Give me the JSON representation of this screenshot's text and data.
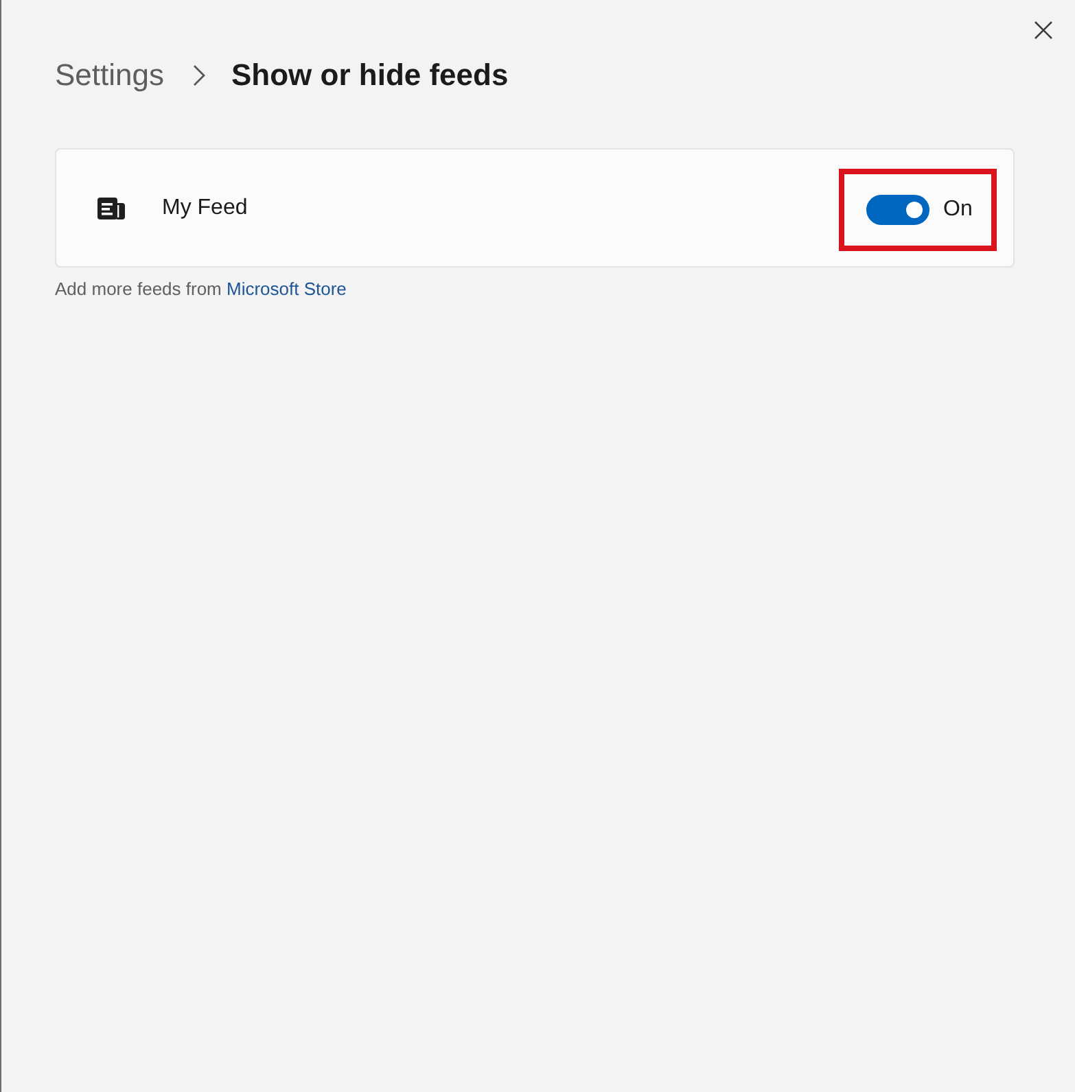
{
  "breadcrumb": [
    {
      "label": "Settings",
      "current": false
    },
    {
      "label": "Show or hide feeds",
      "current": true
    }
  ],
  "feeds": [
    {
      "name": "My Feed",
      "on": true,
      "state_label": "On",
      "highlighted": true
    }
  ],
  "footer": {
    "text": "Add more feeds from",
    "link": "Microsoft Store"
  }
}
